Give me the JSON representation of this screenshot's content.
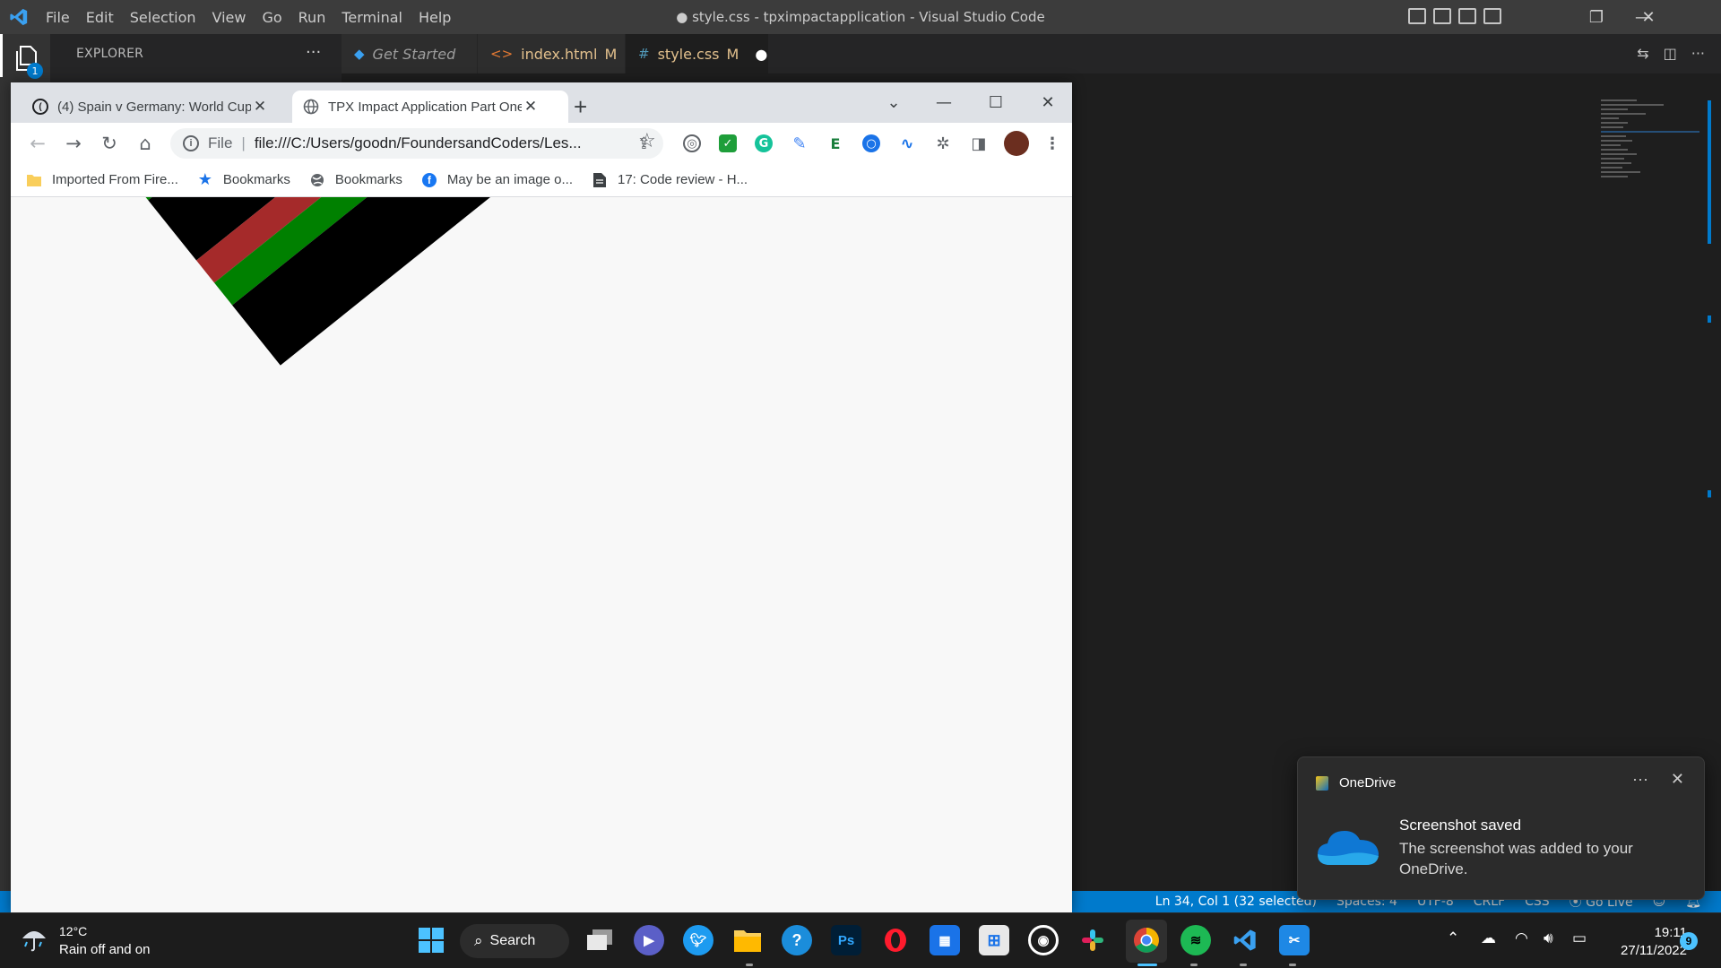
{
  "vscode": {
    "menu": [
      "File",
      "Edit",
      "Selection",
      "View",
      "Go",
      "Run",
      "Terminal",
      "Help"
    ],
    "title": "● style.css - tpximpactapplication - Visual Studio Code",
    "sidebar_title": "EXPLORER",
    "activity_badge": "1",
    "tabs": [
      {
        "label": "Get Started",
        "badge": ""
      },
      {
        "label": "index.html",
        "badge": "M"
      },
      {
        "label": "style.css",
        "badge": "M"
      }
    ],
    "status": {
      "position": "Ln 34, Col 1 (32 selected)",
      "spaces": "Spaces: 4",
      "encoding": "UTF-8",
      "eol": "CRLF",
      "language": "CSS",
      "golive": "Go Live"
    },
    "colors": {
      "accent": "#007acc",
      "titlebar": "#3c3c3c"
    }
  },
  "chrome": {
    "tabs": [
      {
        "title": "(4) Spain v Germany: World Cup 2022"
      },
      {
        "title": "TPX Impact Application Part One"
      }
    ],
    "omnibox": {
      "scheme": "File",
      "url": "file:///C:/Users/goodn/FoundersandCoders/Les..."
    },
    "bookmarks": [
      {
        "label": "Imported From Fire...",
        "icon": "folder-icon"
      },
      {
        "label": "Bookmarks",
        "icon": "star-icon"
      },
      {
        "label": "Bookmarks",
        "icon": "globe-icon"
      },
      {
        "label": "May be an image o...",
        "icon": "facebook-icon"
      },
      {
        "label": "17: Code review - H...",
        "icon": "document-icon"
      }
    ],
    "flag_colors": {
      "black": "#000000",
      "red": "#a52a2a",
      "green": "#008000"
    }
  },
  "toast": {
    "app": "OneDrive",
    "heading": "Screenshot saved",
    "body": "The screenshot was added to your OneDrive."
  },
  "taskbar": {
    "weather": {
      "temp": "12°C",
      "desc": "Rain off and on"
    },
    "search_label": "Search",
    "clock": {
      "time": "19:11",
      "date": "27/11/2022"
    },
    "notification_count": "9"
  }
}
